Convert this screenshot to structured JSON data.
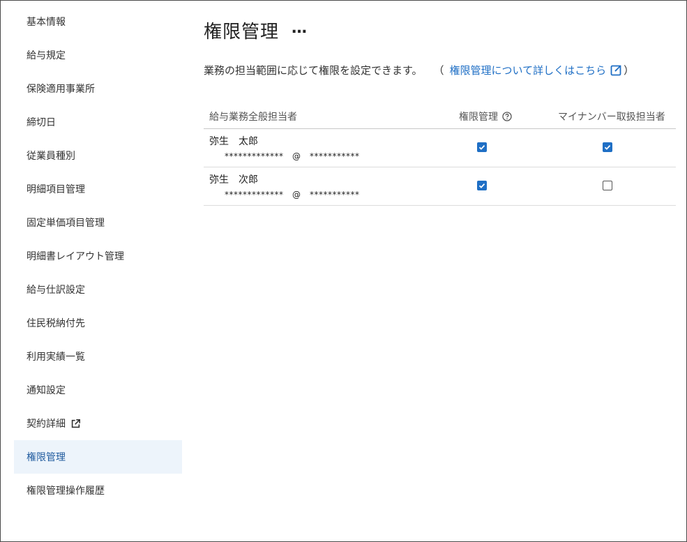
{
  "sidebar": {
    "items": [
      {
        "label": "基本情報"
      },
      {
        "label": "給与規定"
      },
      {
        "label": "保険適用事業所"
      },
      {
        "label": "締切日"
      },
      {
        "label": "従業員種別"
      },
      {
        "label": "明細項目管理"
      },
      {
        "label": "固定単価項目管理"
      },
      {
        "label": "明細書レイアウト管理"
      },
      {
        "label": "給与仕訳設定"
      },
      {
        "label": "住民税納付先"
      },
      {
        "label": "利用実績一覧"
      },
      {
        "label": "通知設定"
      },
      {
        "label": "契約詳細",
        "icon": "external-link-icon"
      },
      {
        "label": "権限管理",
        "active": true
      },
      {
        "label": "権限管理操作履歴"
      }
    ]
  },
  "main": {
    "title": "権限管理",
    "more": "…",
    "description": "業務の担当範囲に応じて権限を設定できます。",
    "paren_open": "（",
    "link_text": "権限管理について詳しくはこちら",
    "paren_close": "）"
  },
  "table": {
    "headers": {
      "name": "給与業務全般担当者",
      "perm": "権限管理",
      "mynum": "マイナンバー取扱担当者"
    },
    "rows": [
      {
        "name": "弥生　太郎",
        "email": "*************　@　***********",
        "perm": true,
        "mynum": true
      },
      {
        "name": "弥生　次郎",
        "email": "*************　@　***********",
        "perm": true,
        "mynum": false
      }
    ]
  },
  "colors": {
    "accent": "#1f6fc5",
    "active_bg": "#edf4fb",
    "border": "#c8c8c8"
  }
}
